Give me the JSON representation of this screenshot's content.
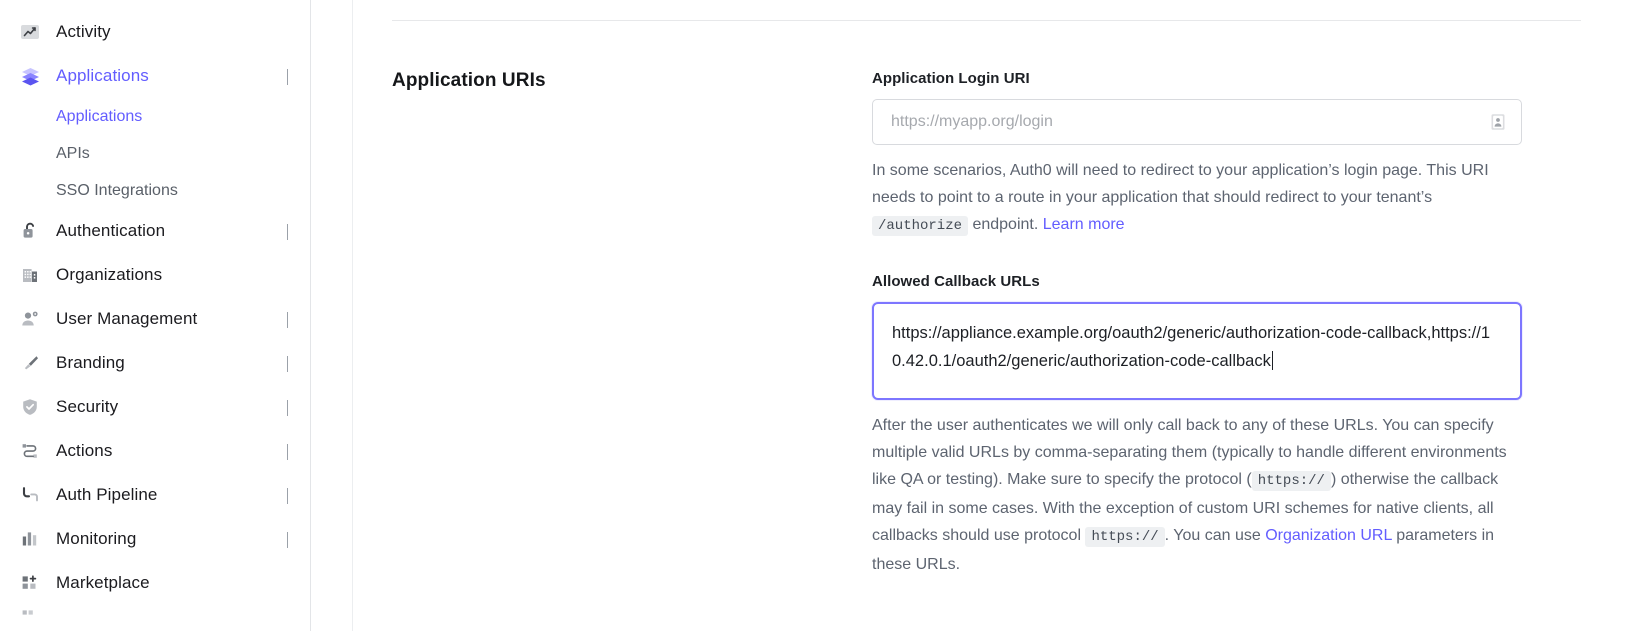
{
  "sidebar": {
    "items": [
      {
        "label": "Activity",
        "icon": "activity-chart-icon",
        "expandable": false,
        "active": false
      },
      {
        "label": "Applications",
        "icon": "layers-icon",
        "expandable": true,
        "expanded": true,
        "active": true
      },
      {
        "label": "Authentication",
        "icon": "unlock-icon",
        "expandable": true,
        "active": false
      },
      {
        "label": "Organizations",
        "icon": "building-icon",
        "expandable": false,
        "active": false
      },
      {
        "label": "User Management",
        "icon": "user-settings-icon",
        "expandable": true,
        "active": false
      },
      {
        "label": "Branding",
        "icon": "paintbrush-icon",
        "expandable": true,
        "active": false
      },
      {
        "label": "Security",
        "icon": "shield-check-icon",
        "expandable": true,
        "active": false
      },
      {
        "label": "Actions",
        "icon": "flow-nodes-icon",
        "expandable": true,
        "active": false
      },
      {
        "label": "Auth Pipeline",
        "icon": "pipeline-icon",
        "expandable": true,
        "active": false
      },
      {
        "label": "Monitoring",
        "icon": "bar-chart-icon",
        "expandable": true,
        "active": false
      },
      {
        "label": "Marketplace",
        "icon": "grid-plus-icon",
        "expandable": false,
        "active": false
      }
    ],
    "sub_items": [
      {
        "label": "Applications",
        "active": true
      },
      {
        "label": "APIs",
        "active": false
      },
      {
        "label": "SSO Integrations",
        "active": false
      }
    ]
  },
  "main": {
    "section_title": "Application URIs",
    "login_uri": {
      "label": "Application Login URI",
      "value": "",
      "placeholder": "https://myapp.org/login",
      "icon": "certificate-badge-icon",
      "help_part1": "In some scenarios, Auth0 will need to redirect to your application’s login page. This URI needs to point to a route in your application that should redirect to your tenant’s ",
      "help_code": "/authorize",
      "help_part2": " endpoint. ",
      "help_link": "Learn more"
    },
    "callback_urls": {
      "label": "Allowed Callback URLs",
      "value": "https://appliance.example.org/oauth2/generic/authorization-code-callback,https://10.42.0.1/oauth2/generic/authorization-code-callback",
      "help_part1": "After the user authenticates we will only call back to any of these URLs. You can specify multiple valid URLs by comma-separating them (typically to handle different environments like QA or testing). Make sure to specify the protocol (",
      "help_code1": "https://",
      "help_part2": ") otherwise the callback may fail in some cases. With the exception of custom URI schemes for native clients, all callbacks should use protocol ",
      "help_code2": "https://",
      "help_part3": ". You can use ",
      "help_link": "Organization URL",
      "help_part4": " parameters in these URLs."
    }
  },
  "colors": {
    "accent": "#635dff",
    "focus_border": "#7d76ff",
    "text_primary": "#1d2025",
    "text_muted": "#5d6470",
    "border": "#d8dade"
  }
}
